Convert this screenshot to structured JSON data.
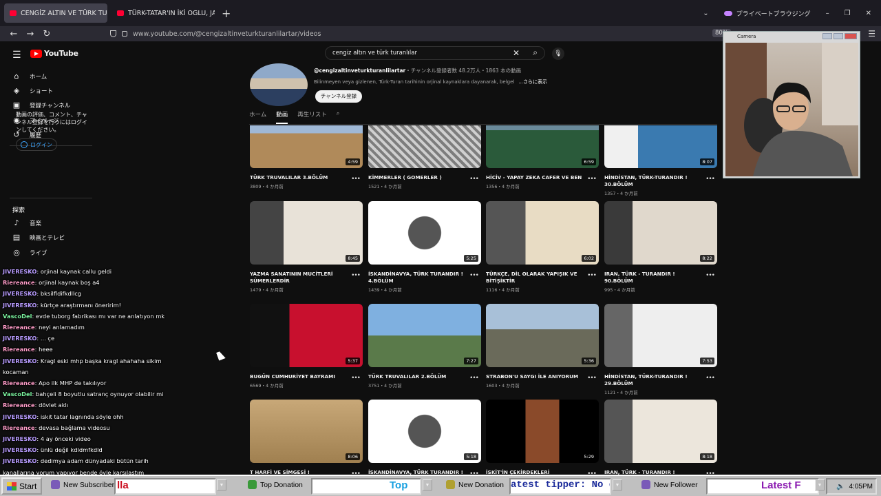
{
  "browser": {
    "tabs": [
      {
        "label": "CENGİZ ALTIN VE TÜRK TURAN"
      },
      {
        "label": "TÜRK-TATAR'IN İKİ OGLU, JAPO"
      }
    ],
    "private_label": "プライベートブラウジング",
    "url": "www.youtube.com/@cengizaltinveturkturanlilartar/videos",
    "zoom": "80%"
  },
  "youtube": {
    "logo_text": "YouTube",
    "search_value": "cengiz altın ve türk turanlılar",
    "sidebar": {
      "items": [
        {
          "label": "ホーム",
          "icon": "home-icon"
        },
        {
          "label": "ショート",
          "icon": "shorts-icon"
        },
        {
          "label": "登録チャンネル",
          "icon": "subscriptions-icon"
        },
        {
          "label": "マイページ",
          "icon": "user-icon"
        },
        {
          "label": "履歴",
          "icon": "history-icon"
        }
      ],
      "signin_prompt": "動画の評価、コメント、チャンネル登録を行うにはログインしてください。",
      "signin_button": "ログイン",
      "explore_heading": "探索",
      "explore_items": [
        {
          "label": "音楽",
          "icon": "music-icon"
        },
        {
          "label": "映画とテレビ",
          "icon": "film-icon"
        },
        {
          "label": "ライブ",
          "icon": "live-icon"
        }
      ]
    },
    "channel": {
      "handle": "@cengizaltinveturkturanlilartar",
      "stats": "・チャンネル登録者数 48.2万人・1863 本の動画",
      "description": "Bilinmeyen veya gizlenen, Türk-Turan tarihinin orjinal kaynaklara dayanarak, belgel",
      "more": "...さらに表示",
      "subscribe": "チャンネル登録",
      "tabs": [
        "ホーム",
        "動画",
        "再生リスト"
      ]
    },
    "videos": [
      {
        "title": "TÜRK TRUVALILAR 3.BÖLÜM",
        "meta": "3809・4 か月前",
        "duration": "4:59"
      },
      {
        "title": "KİMMERLER ( GOMERLER )",
        "meta": "1521・4 か月前",
        "duration": ""
      },
      {
        "title": "HİCİV - YAPAY ZEKA CAFER VE BEN",
        "meta": "1356・4 か月前",
        "duration": "6:59"
      },
      {
        "title": "HİNDİSTAN, TÜRK-TURANDIR ! 30.BÖLÜM",
        "meta": "1357・4 か月前",
        "duration": "8:07"
      },
      {
        "title": "YAZMA SANATININ MUCİTLERİ SÜMERLERDİR",
        "meta": "1479・4 か月前",
        "duration": "8:45"
      },
      {
        "title": "İSKANDİNAVYA, TÜRK TURANDIR ! 4.BÖLÜM",
        "meta": "1439・4 か月前",
        "duration": "5:25"
      },
      {
        "title": "TÜRKÇE, DİL OLARAK YAPIŞIK VE BİTİŞİKTİR",
        "meta": "1116・4 か月前",
        "duration": "6:02"
      },
      {
        "title": "IRAN, TÜRK - TURANDIR ! 90.BÖLÜM",
        "meta": "995・4 か月前",
        "duration": "8:22"
      },
      {
        "title": "BUGÜN CUMHURİYET BAYRAMI",
        "meta": "6569・4 か月前",
        "duration": "5:37"
      },
      {
        "title": "TÜRK TRUVALILAR 2.BÖLÜM",
        "meta": "3751・4 か月前",
        "duration": "7:27"
      },
      {
        "title": "STRABON'U SAYGI İLE ANIYORUM",
        "meta": "1603・4 か月前",
        "duration": "5:36"
      },
      {
        "title": "HİNDİSTAN, TÜRK-TURANDIR ! 29.BÖLÜM",
        "meta": "1121・4 か月前",
        "duration": "7:53"
      },
      {
        "title": "T HARFİ VE SİMGESİ !",
        "meta": "",
        "duration": "8:06"
      },
      {
        "title": "İSKANDİNAVYA, TÜRK TURANDIR !",
        "meta": "",
        "duration": "5:18"
      },
      {
        "title": "İSKİT'İN ÇEKİRDEKLERİ",
        "meta": "",
        "duration": "5:29"
      },
      {
        "title": "IRAN, TÜRK - TURANDIR ! 89.BÖLÜM",
        "meta": "",
        "duration": "8:18"
      }
    ]
  },
  "camera": {
    "title": "Camera"
  },
  "chat": [
    {
      "user": "JIVERESKO",
      "text": "orjinal kaynak callu geldi",
      "color": "#b89cff"
    },
    {
      "user": "Riereance",
      "text": "orjinal kaynak boş a4",
      "color": "#ff9cc8"
    },
    {
      "user": "JIVERESKO",
      "text": "bksilfldifkdllcg",
      "color": "#b89cff"
    },
    {
      "user": "JIVERESKO",
      "text": "kürtçe araştırmanı öneririm!",
      "color": "#b89cff"
    },
    {
      "user": "VascoDel",
      "text": "evde tuborg fabrikası mı var ne anlatıyon mk",
      "color": "#7cf5a0"
    },
    {
      "user": "Riereance",
      "text": "neyi anlamadım",
      "color": "#ff9cc8"
    },
    {
      "user": "JIVERESKO",
      "text": "... çe",
      "color": "#b89cff"
    },
    {
      "user": "Riereance",
      "text": "heee",
      "color": "#ff9cc8"
    },
    {
      "user": "JIVERESKO",
      "text": "Kragl eski mhp başka kragl ahahaha sikim",
      "color": "#b89cff"
    },
    {
      "user": "",
      "text": "kocaman",
      "color": "#b89cff"
    },
    {
      "user": "Riereance",
      "text": "Apo ilk MHP de takılıyor",
      "color": "#ff9cc8"
    },
    {
      "user": "VascoDel",
      "text": "bahçeli 8 boyutlu satranç oynuyor olabilir mi",
      "color": "#7cf5a0"
    },
    {
      "user": "Riereance",
      "text": "dövlet aklı",
      "color": "#ff9cc8"
    },
    {
      "user": "JIVERESKO",
      "text": "iskit tatar lagnında söyle ohh",
      "color": "#b89cff"
    },
    {
      "user": "Riereance",
      "text": "devasa bağlama videosu",
      "color": "#ff9cc8"
    },
    {
      "user": "JIVERESKO",
      "text": "4 ay önceki video",
      "color": "#b89cff"
    },
    {
      "user": "JIVERESKO",
      "text": "ünlü değil kdldmfkdld",
      "color": "#b89cff"
    },
    {
      "user": "JIVERESKO",
      "text": "dedimya adam dünyadaki bütün tarih",
      "color": "#b89cff"
    },
    {
      "user": "",
      "text": "kanallarına yorum yapıyor bende öyle karşılaştım",
      "color": "#b89cff"
    }
  ],
  "taskbar": {
    "start": "Start",
    "new_subscriber": "New Subscriber",
    "sub_field": "lla",
    "top_donation": "Top Donation",
    "top_field": "Top",
    "new_donation": "New Donation",
    "donation_field": "atest tipper: No d",
    "new_follower": "New Follower",
    "follower_field": "Latest F",
    "clock": "4:05PM"
  }
}
